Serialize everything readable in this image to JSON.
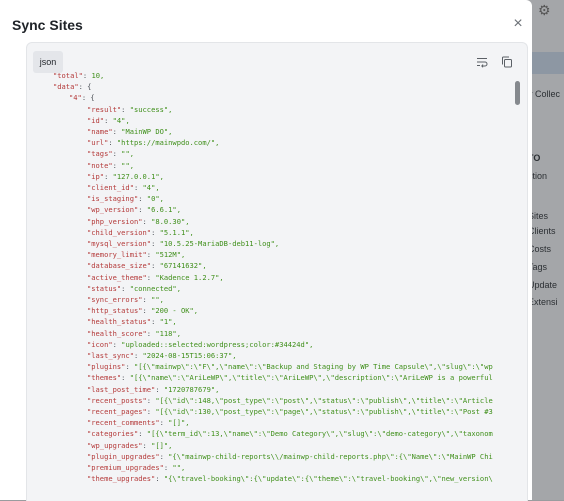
{
  "background": {
    "left_fragments": [
      "PI",
      "orico",
      "RT]",
      "t A",
      "W",
      "io",
      "Sype",
      "PI",
      "tes",
      "tes",
      "ites",
      "ites",
      "ites",
      "nnec",
      "Sit",
      "tes",
      "tes"
    ],
    "right_fragments": [
      "v Collec",
      "TO",
      "ction",
      "Sites",
      "Clients",
      "Costs",
      "Tags",
      "Update",
      "Extensi"
    ]
  },
  "modal": {
    "title": "Sync Sites",
    "close_icon": "×",
    "code_language": "json",
    "wrap_icon": "wrap-lines-icon",
    "copy_icon": "copy-icon"
  },
  "code_lines": [
    {
      "indent": 1,
      "key": "total",
      "value": "10,",
      "vtype": "n"
    },
    {
      "indent": 1,
      "key": "data",
      "value": "{",
      "vtype": "p"
    },
    {
      "indent": 2,
      "key": "4",
      "value": "{",
      "vtype": "p"
    },
    {
      "indent": 3,
      "key": "result",
      "value": "\"success\",",
      "vtype": "s"
    },
    {
      "indent": 3,
      "key": "id",
      "value": "\"4\",",
      "vtype": "s"
    },
    {
      "indent": 3,
      "key": "name",
      "value": "\"MainWP DO\",",
      "vtype": "s"
    },
    {
      "indent": 3,
      "key": "url",
      "value": "\"https://mainwpdo.com/\",",
      "vtype": "s"
    },
    {
      "indent": 3,
      "key": "tags",
      "value": "\"\",",
      "vtype": "s"
    },
    {
      "indent": 3,
      "key": "note",
      "value": "\"\",",
      "vtype": "s"
    },
    {
      "indent": 3,
      "key": "ip",
      "value": "\"127.0.0.1\",",
      "vtype": "s"
    },
    {
      "indent": 3,
      "key": "client_id",
      "value": "\"4\",",
      "vtype": "s"
    },
    {
      "indent": 3,
      "key": "is_staging",
      "value": "\"0\",",
      "vtype": "s"
    },
    {
      "indent": 3,
      "key": "wp_version",
      "value": "\"6.6.1\",",
      "vtype": "s"
    },
    {
      "indent": 3,
      "key": "php_version",
      "value": "\"8.0.30\",",
      "vtype": "s"
    },
    {
      "indent": 3,
      "key": "child_version",
      "value": "\"5.1.1\",",
      "vtype": "s"
    },
    {
      "indent": 3,
      "key": "mysql_version",
      "value": "\"10.5.25-MariaDB-deb11-log\",",
      "vtype": "s"
    },
    {
      "indent": 3,
      "key": "memory_limit",
      "value": "\"512M\",",
      "vtype": "s"
    },
    {
      "indent": 3,
      "key": "database_size",
      "value": "\"67141632\",",
      "vtype": "s"
    },
    {
      "indent": 3,
      "key": "active_theme",
      "value": "\"Kadence 1.2.7\",",
      "vtype": "s"
    },
    {
      "indent": 3,
      "key": "status",
      "value": "\"connected\",",
      "vtype": "s"
    },
    {
      "indent": 3,
      "key": "sync_errors",
      "value": "\"\",",
      "vtype": "s"
    },
    {
      "indent": 3,
      "key": "http_status",
      "value": "\"200 - OK\",",
      "vtype": "s"
    },
    {
      "indent": 3,
      "key": "health_status",
      "value": "\"1\",",
      "vtype": "s"
    },
    {
      "indent": 3,
      "key": "health_score",
      "value": "\"118\",",
      "vtype": "s"
    },
    {
      "indent": 3,
      "key": "icon",
      "value": "\"uploaded::selected:wordpress;color:#34424d\",",
      "vtype": "s"
    },
    {
      "indent": 3,
      "key": "last_sync",
      "value": "\"2024-08-15T15:06:37\",",
      "vtype": "s"
    },
    {
      "indent": 3,
      "key": "plugins",
      "value": "\"[{\\\"mainwp\\\":\\\"F\\\",\\\"name\\\":\\\"Backup and Staging by WP Time Capsule\\\",\\\"slug\\\":\\\"wp",
      "vtype": "s"
    },
    {
      "indent": 3,
      "key": "themes",
      "value": "\"[{\\\"name\\\":\\\"AriLeWP\\\",\\\"title\\\":\\\"AriLeWP\\\",\\\"description\\\":\\\"AriLeWP is a powerful",
      "vtype": "s"
    },
    {
      "indent": 3,
      "key": "last_post_time",
      "value": "\"1720787679\",",
      "vtype": "s"
    },
    {
      "indent": 3,
      "key": "recent_posts",
      "value": "\"[{\\\"id\\\":148,\\\"post_type\\\":\\\"post\\\",\\\"status\\\":\\\"publish\\\",\\\"title\\\":\\\"Article",
      "vtype": "s"
    },
    {
      "indent": 3,
      "key": "recent_pages",
      "value": "\"[{\\\"id\\\":130,\\\"post_type\\\":\\\"page\\\",\\\"status\\\":\\\"publish\\\",\\\"title\\\":\\\"Post #3",
      "vtype": "s"
    },
    {
      "indent": 3,
      "key": "recent_comments",
      "value": "\"[]\",",
      "vtype": "s"
    },
    {
      "indent": 3,
      "key": "categories",
      "value": "\"[{\\\"term_id\\\":13,\\\"name\\\":\\\"Demo Category\\\",\\\"slug\\\":\\\"demo-category\\\",\\\"taxonom",
      "vtype": "s"
    },
    {
      "indent": 3,
      "key": "wp_upgrades",
      "value": "\"[]\",",
      "vtype": "s"
    },
    {
      "indent": 3,
      "key": "plugin_upgrades",
      "value": "\"{\\\"mainwp-child-reports\\\\/mainwp-child-reports.php\\\":{\\\"Name\\\":\\\"MainWP Chi",
      "vtype": "s"
    },
    {
      "indent": 3,
      "key": "premium_upgrades",
      "value": "\"\",",
      "vtype": "s"
    },
    {
      "indent": 3,
      "key": "theme_upgrades",
      "value": "\"{\\\"travel-booking\\\":{\\\"update\\\":{\\\"theme\\\":\\\"travel-booking\\\",\\\"new_version\\",
      "vtype": "s"
    }
  ]
}
